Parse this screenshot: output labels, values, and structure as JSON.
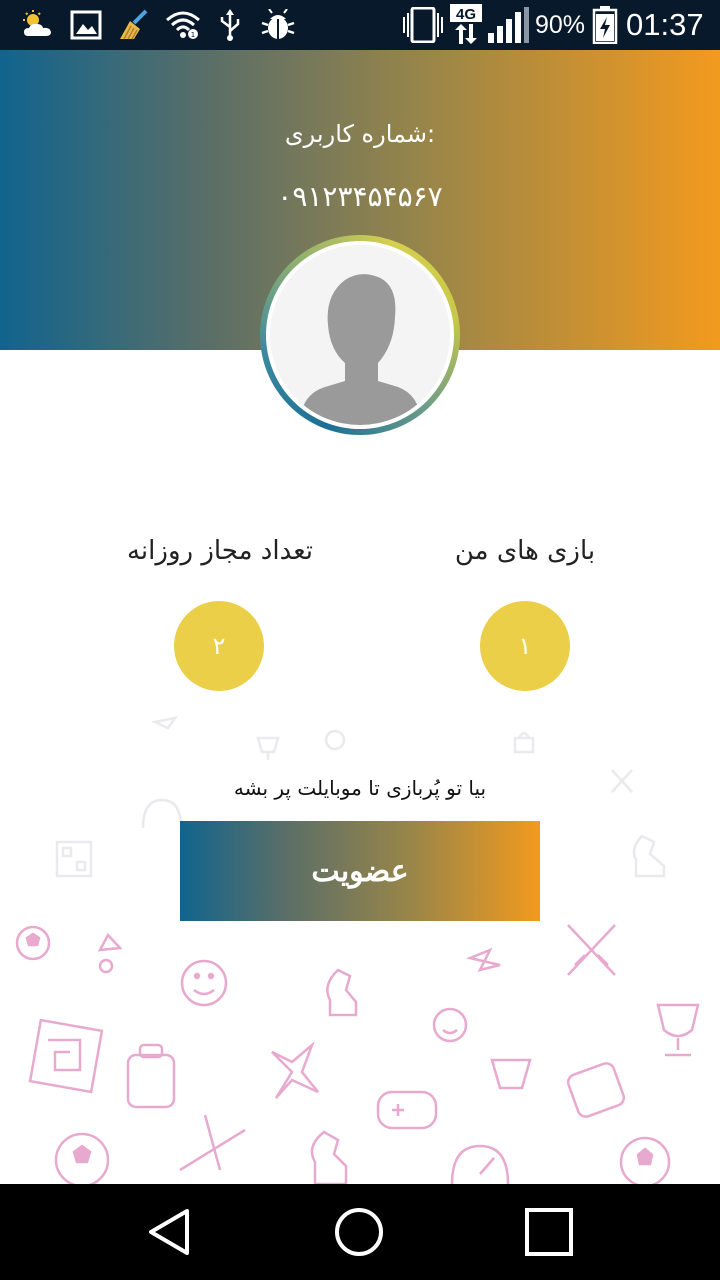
{
  "status_bar": {
    "icons_left": [
      "weather-icon",
      "gallery-icon",
      "cleaner-icon",
      "wifi-icon",
      "usb-icon",
      "debug-icon"
    ],
    "icons_right": [
      "vibrate-icon",
      "network-4g-icon",
      "signal-icon",
      "battery-icon"
    ],
    "network_label": "4G",
    "battery_percent": "90%",
    "time": "01:37"
  },
  "profile": {
    "user_label": "شماره کاربری:",
    "phone": "۰۹۱۲۳۴۵۴۵۶۷",
    "avatar": "default-user-avatar"
  },
  "stats": {
    "my_games_label": "بازی های من",
    "my_games_value": "۱",
    "daily_allowed_label": "تعداد مجاز روزانه",
    "daily_allowed_value": "۲"
  },
  "promo": {
    "text": "بیا تو پُربازی تا موبایلت پر بشه",
    "join_button": "عضویت"
  },
  "colors": {
    "gradient_start": "#11648e",
    "gradient_end": "#f29a1e",
    "circle_yellow": "#ebcf48",
    "doodle_pink": "#e07fbf"
  },
  "nav_bar": {
    "buttons": [
      "back-icon",
      "home-icon",
      "recents-icon"
    ]
  }
}
